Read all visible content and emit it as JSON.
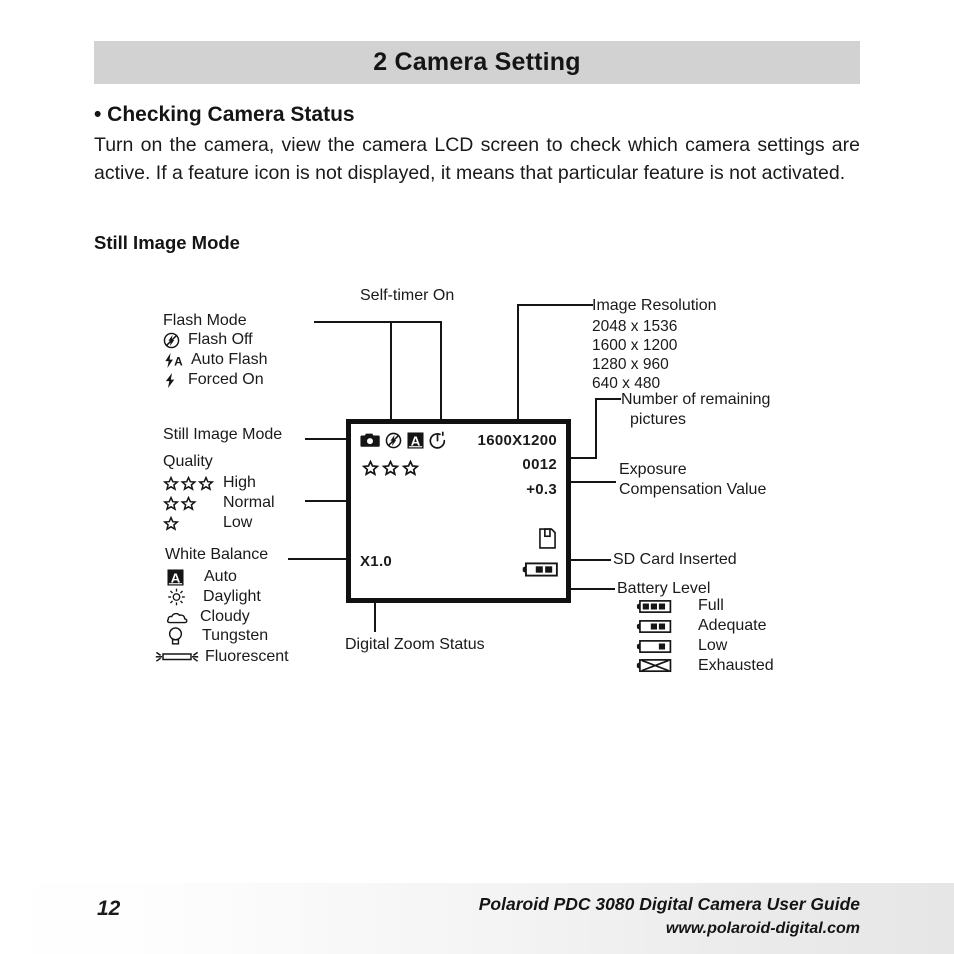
{
  "header": {
    "title": "2 Camera Setting"
  },
  "content": {
    "section_bullet": "• Checking Camera Status",
    "intro": "Turn on the camera, view the camera LCD screen to check which camera settings are active. If a feature icon is not displayed, it means that particular feature is not activated.",
    "still_image_heading": "Still Image Mode"
  },
  "diagram": {
    "self_timer_label": "Self-timer On",
    "flash_mode": {
      "title": "Flash Mode",
      "items": [
        {
          "icon": "flash-off-icon",
          "label": "Flash Off"
        },
        {
          "icon": "auto-flash-icon",
          "label": "Auto Flash"
        },
        {
          "icon": "forced-flash-icon",
          "label": "Forced On"
        }
      ]
    },
    "still_image_mode_label": "Still Image Mode",
    "quality": {
      "title": "Quality",
      "items": [
        {
          "icon": "three-stars-icon",
          "stars": 3,
          "label": "High"
        },
        {
          "icon": "two-stars-icon",
          "stars": 2,
          "label": "Normal"
        },
        {
          "icon": "one-star-icon",
          "stars": 1,
          "label": "Low"
        }
      ]
    },
    "white_balance": {
      "title": "White Balance",
      "items": [
        {
          "icon": "auto-wb-icon",
          "label": "Auto"
        },
        {
          "icon": "daylight-icon",
          "label": "Daylight"
        },
        {
          "icon": "cloudy-icon",
          "label": "Cloudy"
        },
        {
          "icon": "tungsten-icon",
          "label": "Tungsten"
        },
        {
          "icon": "fluorescent-icon",
          "label": "Fluorescent"
        }
      ]
    },
    "digital_zoom_label": "Digital Zoom Status",
    "image_resolution": {
      "title": "Image Resolution",
      "options": [
        "2048 x 1536",
        "1600 x 1200",
        "1280 x 960",
        "640 x 480"
      ]
    },
    "remaining_pictures_label_line1": "Number of remaining",
    "remaining_pictures_label_line2": "pictures",
    "exposure_label_line1": "Exposure",
    "exposure_label_line2": "Compensation Value",
    "sd_card_label": "SD Card Inserted",
    "battery": {
      "title": "Battery Level",
      "items": [
        {
          "icon": "battery-full-icon",
          "bars": 3,
          "label": "Full"
        },
        {
          "icon": "battery-adequate-icon",
          "bars": 2,
          "label": "Adequate"
        },
        {
          "icon": "battery-low-icon",
          "bars": 1,
          "label": "Low"
        },
        {
          "icon": "battery-exhausted-icon",
          "bars": 0,
          "label": "Exhausted"
        }
      ]
    },
    "lcd_screen": {
      "mode_icon": "still-image-mode-icon",
      "flash_icon": "flash-off-icon",
      "wb_icon": "auto-wb-icon",
      "timer_icon": "self-timer-icon",
      "resolution": "1600X1200",
      "remaining": "0012",
      "exposure_value": "+0.3",
      "quality_stars": 3,
      "zoom": "X1.0",
      "sd_icon": "sd-card-icon",
      "battery_icon": "battery-adequate-icon"
    }
  },
  "footer": {
    "page_number": "12",
    "guide_title": "Polaroid PDC 3080 Digital Camera User Guide",
    "url": "www.polaroid-digital.com"
  },
  "colors": {
    "header_band": "#d2d2d2",
    "ink": "#151515",
    "page_bg": "#ffffff"
  }
}
